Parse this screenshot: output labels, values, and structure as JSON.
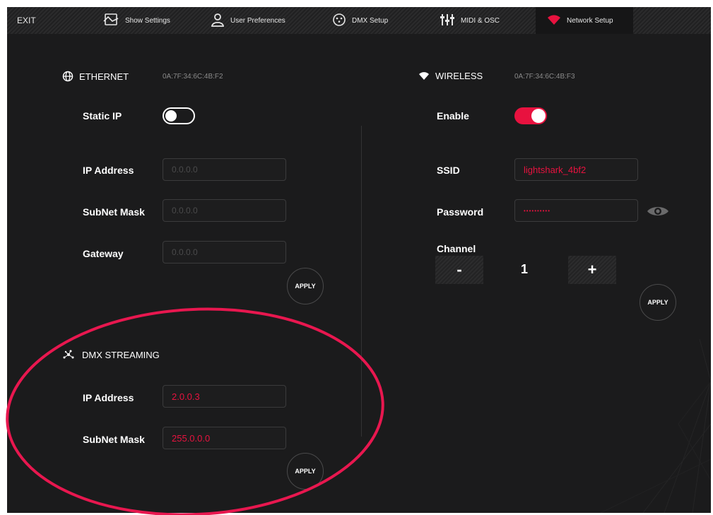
{
  "nav": {
    "exit_label": "EXIT",
    "items": [
      {
        "label": "Show Settings",
        "icon": "show-settings-icon"
      },
      {
        "label": "User Preferences",
        "icon": "user-icon"
      },
      {
        "label": "DMX Setup",
        "icon": "dmx-connector-icon"
      },
      {
        "label": "MIDI & OSC",
        "icon": "midi-sliders-icon"
      },
      {
        "label": "Network Setup",
        "icon": "wifi-icon"
      }
    ],
    "active": "Network Setup"
  },
  "ethernet": {
    "title": "ETHERNET",
    "mac": "0A:7F:34:6C:4B:F2",
    "static_ip_label": "Static IP",
    "static_ip_enabled": false,
    "ip_label": "IP Address",
    "ip_value": "0.0.0.0",
    "subnet_label": "SubNet Mask",
    "subnet_value": "0.0.0.0",
    "gateway_label": "Gateway",
    "gateway_value": "0.0.0.0",
    "apply_label": "APPLY"
  },
  "wireless": {
    "title": "WIRELESS",
    "mac": "0A:7F:34:6C:4B:F3",
    "enable_label": "Enable",
    "enabled": true,
    "ssid_label": "SSID",
    "ssid_value": "lightshark_4bf2",
    "password_label": "Password",
    "password_value": "••••••••••",
    "channel_label": "Channel",
    "channel_minus": "-",
    "channel_value": "1",
    "channel_plus": "+",
    "apply_label": "APPLY"
  },
  "dmx_streaming": {
    "title": "DMX STREAMING",
    "ip_label": "IP Address",
    "ip_value": "2.0.0.3",
    "subnet_label": "SubNet Mask",
    "subnet_value": "255.0.0.0",
    "apply_label": "APPLY"
  },
  "colors": {
    "accent": "#e8123f",
    "background": "#1b1b1c",
    "annotation": "#e8174f"
  }
}
